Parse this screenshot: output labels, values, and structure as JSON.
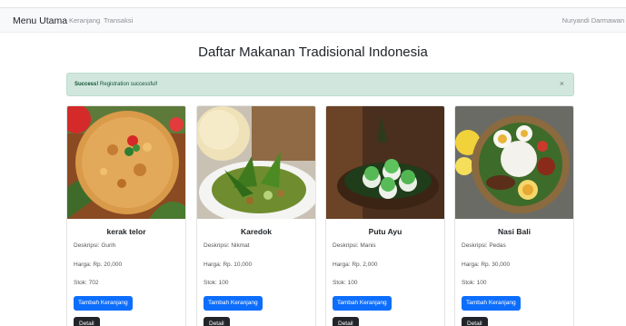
{
  "navbar": {
    "brand": "Menu Utama",
    "links": [
      "Keranjang",
      "Transaksi"
    ],
    "user": "Nuryandi Darmawan"
  },
  "page": {
    "title": "Daftar Makanan Tradisional Indonesia"
  },
  "alert": {
    "strong": "Success!",
    "message": " Registration successful!",
    "close": "×"
  },
  "products": [
    {
      "name": "kerak telor",
      "deskripsi": "Deskripsi: Gurih",
      "harga": "Harga: Rp. 20,000",
      "stok": "Stok: 702",
      "add_label": "Tambah Keranjang",
      "detail_label": "Detail"
    },
    {
      "name": "Karedok",
      "deskripsi": "Deskripsi: Nikmat",
      "harga": "Harga: Rp. 10,000",
      "stok": "Stok: 100",
      "add_label": "Tambah Keranjang",
      "detail_label": "Detail"
    },
    {
      "name": "Putu Ayu",
      "deskripsi": "Deskripsi: Manis",
      "harga": "Harga: Rp. 2,000",
      "stok": "Stok: 100",
      "add_label": "Tambah Keranjang",
      "detail_label": "Detail"
    },
    {
      "name": "Nasi Bali",
      "deskripsi": "Deskripsi: Pedas",
      "harga": "Harga: Rp. 30,000",
      "stok": "Stok: 100",
      "add_label": "Tambah Keranjang",
      "detail_label": "Detail"
    }
  ],
  "colors": {
    "primary": "#0d6efd",
    "dark": "#212529",
    "alert_bg": "#d1e7dd",
    "alert_text": "#0f5132"
  }
}
